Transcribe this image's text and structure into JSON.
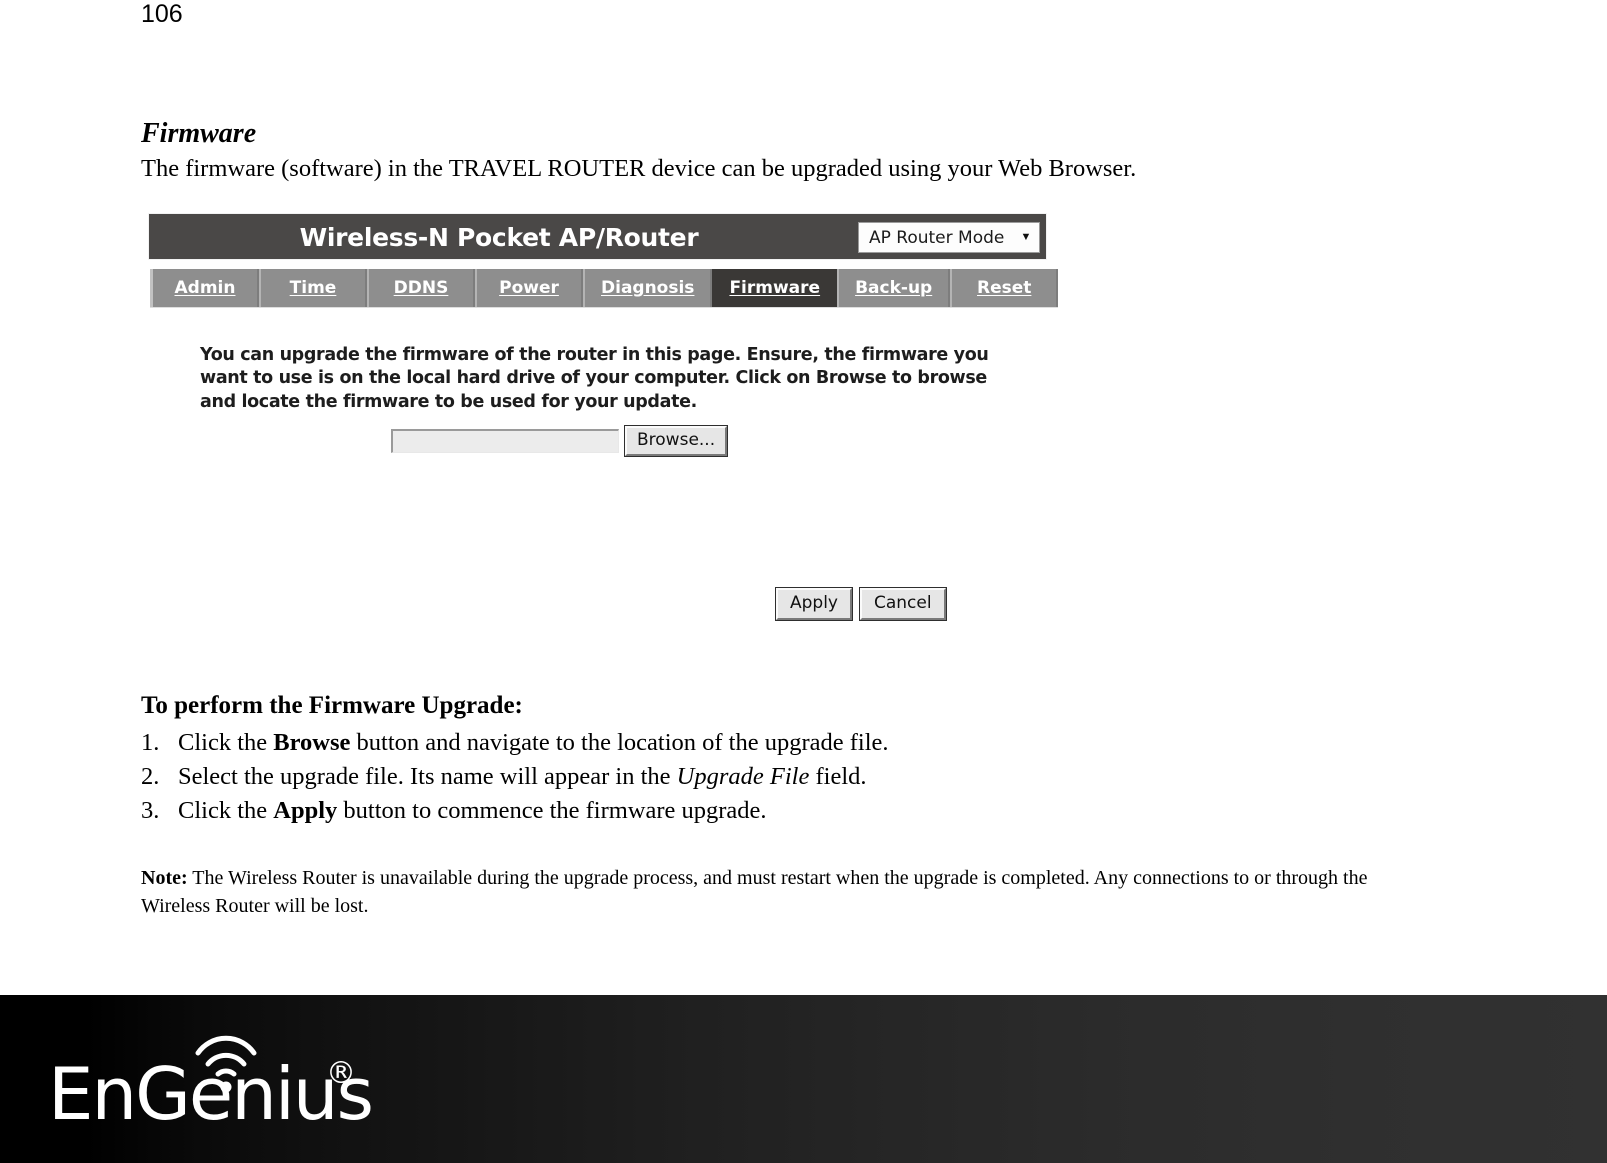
{
  "page": {
    "number": "106"
  },
  "section": {
    "heading": "Firmware",
    "intro": "The firmware (software) in the TRAVEL ROUTER device can be upgraded using your Web Browser."
  },
  "router_ui": {
    "header_title": "Wireless-N Pocket AP/Router",
    "mode_select": {
      "selected": "AP Router Mode",
      "arrow": "▼"
    },
    "tabs": [
      {
        "label": "Admin",
        "active": false
      },
      {
        "label": "Time",
        "active": false
      },
      {
        "label": "DDNS",
        "active": false
      },
      {
        "label": "Power",
        "active": false
      },
      {
        "label": "Diagnosis",
        "active": false
      },
      {
        "label": "Firmware",
        "active": true
      },
      {
        "label": "Back-up",
        "active": false
      },
      {
        "label": "Reset",
        "active": false
      }
    ],
    "description": "You can upgrade the firmware of the router in this page. Ensure, the firmware you want to use is on the local hard drive of your computer. Click on Browse to browse and locate the firmware to be used for your update.",
    "file_field": {
      "value": "",
      "placeholder": ""
    },
    "browse_label": "Browse...",
    "apply_label": "Apply",
    "cancel_label": "Cancel",
    "colors": {
      "header_bg": "#4a4847",
      "nav_bg": "#8e8e8e",
      "active_tab_bg": "#3a3836",
      "button_face": "#e6e6e6",
      "input_bg": "#ececec"
    }
  },
  "instructions": {
    "heading": "To perform the Firmware Upgrade:",
    "steps": [
      {
        "number": "1.",
        "pre": "Click the ",
        "emphasis": "Browse",
        "emphasis_style": "bold",
        "post": " button and navigate to the location of the upgrade file."
      },
      {
        "number": "2.",
        "pre": "Select the upgrade file. Its name will appear in the ",
        "emphasis": "Upgrade File",
        "emphasis_style": "italic",
        "post": " field."
      },
      {
        "number": "3.",
        "pre": "Click the ",
        "emphasis": "Apply",
        "emphasis_style": "bold",
        "post": " button to commence the firmware upgrade."
      }
    ]
  },
  "note": {
    "label": "Note:",
    "text": " The Wireless Router is unavailable during the upgrade process, and must restart when the upgrade is completed. Any connections to or through the Wireless Router will be lost."
  },
  "footer": {
    "brand": "EnGenius",
    "registered_mark": "®",
    "background": "#000000"
  }
}
